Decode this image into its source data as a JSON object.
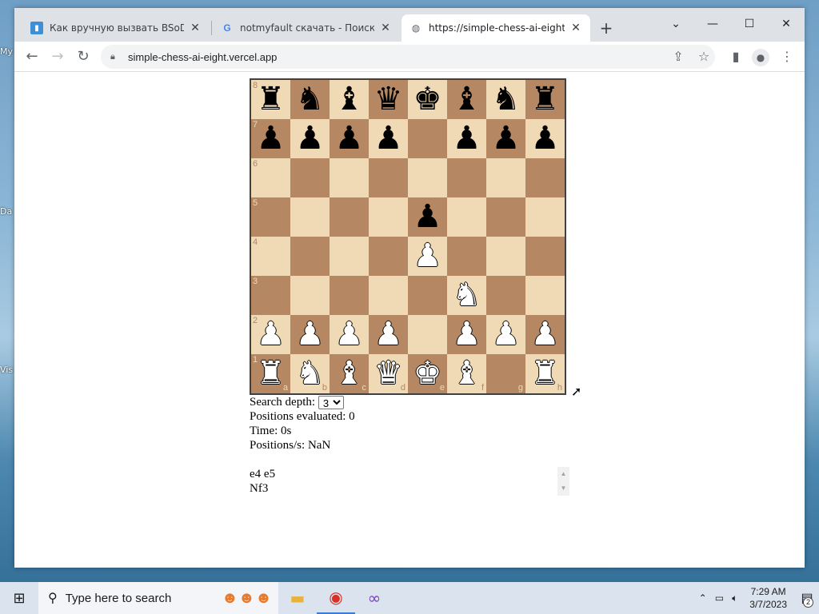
{
  "desktop": {
    "fragments": [
      "My",
      "Da",
      "Vis"
    ]
  },
  "browser": {
    "tabs": [
      {
        "title": "Как вручную вызвать BSoD (си",
        "favicon": "document-icon",
        "active": false
      },
      {
        "title": "notmyfault скачать - Поиск в Go",
        "favicon": "google-icon",
        "active": false
      },
      {
        "title": "https://simple-chess-ai-eight.verc",
        "favicon": "globe-icon",
        "active": true
      }
    ],
    "new_tab": "+",
    "url": "simple-chess-ai-eight.vercel.app"
  },
  "board": {
    "ranks": [
      "8",
      "7",
      "6",
      "5",
      "4",
      "3",
      "2",
      "1"
    ],
    "files": [
      "a",
      "b",
      "c",
      "d",
      "e",
      "f",
      "g",
      "h"
    ],
    "position": [
      [
        "bR",
        "bN",
        "bB",
        "bQ",
        "bK",
        "bB",
        "bN",
        "bR"
      ],
      [
        "bP",
        "bP",
        "bP",
        "bP",
        "",
        "bP",
        "bP",
        "bP"
      ],
      [
        "",
        "",
        "",
        "",
        "",
        "",
        "",
        ""
      ],
      [
        "",
        "",
        "",
        "",
        "bP",
        "",
        "",
        ""
      ],
      [
        "",
        "",
        "",
        "",
        "wP",
        "",
        "",
        ""
      ],
      [
        "",
        "",
        "",
        "",
        "",
        "wN",
        "",
        ""
      ],
      [
        "wP",
        "wP",
        "wP",
        "wP",
        "",
        "wP",
        "wP",
        "wP"
      ],
      [
        "wR",
        "wN",
        "wB",
        "wQ",
        "wK",
        "wB",
        "",
        "wR"
      ]
    ],
    "colors": {
      "light": "#f0d9b5",
      "dark": "#b58863"
    }
  },
  "stats": {
    "depth_label": "Search depth:",
    "depth_value": "3",
    "positions_label": "Positions evaluated:",
    "positions_value": "0",
    "time_label": "Time:",
    "time_value": "0s",
    "rate_label": "Positions/s:",
    "rate_value": "NaN"
  },
  "moves": [
    "e4 e5",
    "Nf3"
  ],
  "taskbar": {
    "search_placeholder": "Type here to search",
    "time": "7:29 AM",
    "date": "3/7/2023",
    "notifications": "2"
  }
}
